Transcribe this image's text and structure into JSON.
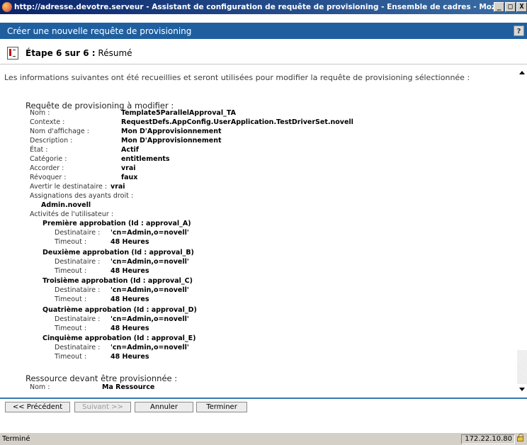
{
  "window": {
    "title": "http://adresse.devotre.serveur - Assistant de configuration de requête de provisioning - Ensemble de cadres - Mozilla Firefox",
    "minimize": "_",
    "maximize": "□",
    "close": "X"
  },
  "header": {
    "title": "Créer une nouvelle requête de provisioning",
    "help": "?"
  },
  "step": {
    "label": "Étape 6 sur 6 :",
    "name": "Résumé"
  },
  "intro": "Les informations suivantes ont été recueillies et seront utilisées pour modifier la requête de provisioning sélectionnée :",
  "request": {
    "title": "Requête de provisioning à modifier :",
    "fields": [
      {
        "label": "Nom :",
        "value": "Template5ParallelApproval_TA"
      },
      {
        "label": "Contexte :",
        "value": "RequestDefs.AppConfig.UserApplication.TestDriverSet.novell"
      },
      {
        "label": "Nom d'affichage :",
        "value": "Mon D'Approvisionnement"
      },
      {
        "label": "Description :",
        "value": "Mon D'Approvisionnement"
      },
      {
        "label": "État :",
        "value": "Actif"
      },
      {
        "label": "Catégorie :",
        "value": "entitlements"
      },
      {
        "label": "Accorder :",
        "value": "vrai"
      },
      {
        "label": "Révoquer :",
        "value": "faux"
      }
    ],
    "notify": {
      "label": "Avertir le destinataire :",
      "value": "vrai"
    },
    "assignments_label": "Assignations des ayants droit :",
    "assignments_value": "Admin.novell",
    "activities_label": "Activités de l'utilisateur :",
    "activities": [
      {
        "title": "Première approbation (Id : approval_A)",
        "recipient_label": "Destinataire :",
        "recipient": "'cn=Admin,o=novell'",
        "timeout_label": "Timeout :",
        "timeout": "48 Heures"
      },
      {
        "title": "Deuxième approbation (Id : approval_B)",
        "recipient_label": "Destinataire :",
        "recipient": "'cn=Admin,o=novell'",
        "timeout_label": "Timeout :",
        "timeout": "48 Heures"
      },
      {
        "title": "Troisième approbation (Id : approval_C)",
        "recipient_label": "Destinataire :",
        "recipient": "'cn=Admin,o=novell'",
        "timeout_label": "Timeout :",
        "timeout": "48 Heures"
      },
      {
        "title": "Quatrième approbation (Id : approval_D)",
        "recipient_label": "Destinataire :",
        "recipient": "'cn=Admin,o=novell'",
        "timeout_label": "Timeout :",
        "timeout": "48 Heures"
      },
      {
        "title": "Cinquième approbation (Id : approval_E)",
        "recipient_label": "Destinataire :",
        "recipient": "'cn=Admin,o=novell'",
        "timeout_label": "Timeout :",
        "timeout": "48 Heures"
      }
    ]
  },
  "resource": {
    "title": "Ressource devant être provisionnée :",
    "name_label": "Nom :",
    "name_value": "Ma Ressource"
  },
  "buttons": {
    "previous": "<< Précédent",
    "next": "Suivant >>",
    "cancel": "Annuler",
    "finish": "Terminer"
  },
  "status": {
    "text": "Terminé",
    "host": "172.22.10.80"
  }
}
